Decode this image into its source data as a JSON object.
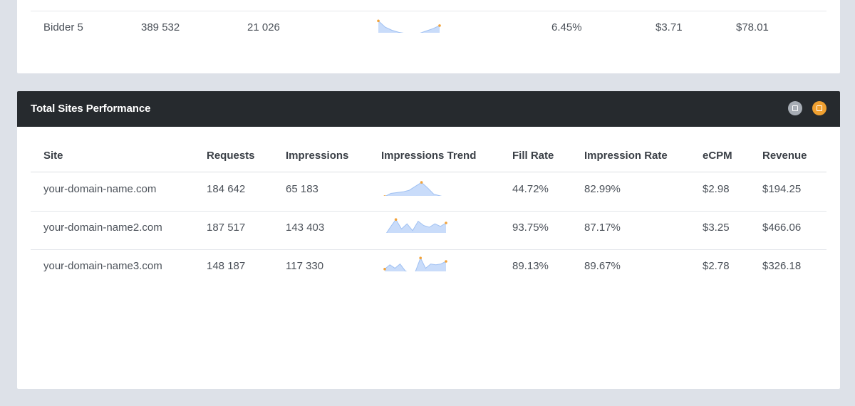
{
  "top_table": {
    "row": {
      "name": "Bidder 5",
      "requests": "389 532",
      "impressions": "21 026",
      "trend": [
        0.85,
        0.45,
        0.25,
        0.12,
        0.05,
        0.0,
        0.05,
        0.2,
        0.35,
        0.55
      ],
      "fill_rate": "6.45%",
      "ecpm": "$3.71",
      "revenue": "$78.01"
    }
  },
  "sites_panel": {
    "title": "Total Sites Performance",
    "controls": {
      "minimize_icon": "minimize-icon",
      "maximize_icon": "maximize-icon"
    },
    "columns": [
      "Site",
      "Requests",
      "Impressions",
      "Impressions Trend",
      "Fill Rate",
      "Impression Rate",
      "eCPM",
      "Revenue"
    ],
    "rows": [
      {
        "site": "your-domain-name.com",
        "requests": "184 642",
        "impressions": "65 183",
        "trend": [
          0.05,
          0.25,
          0.3,
          0.35,
          0.45,
          0.7,
          0.95,
          0.6,
          0.2,
          0.1,
          0.0
        ],
        "fill_rate": "44.72%",
        "impression_rate": "82.99%",
        "ecpm": "$2.98",
        "revenue": "$194.25"
      },
      {
        "site": "your-domain-name2.com",
        "requests": "187 517",
        "impressions": "143 403",
        "trend": [
          0.0,
          0.5,
          0.95,
          0.4,
          0.7,
          0.3,
          0.85,
          0.6,
          0.5,
          0.7,
          0.55,
          0.75
        ],
        "fill_rate": "93.75%",
        "impression_rate": "87.17%",
        "ecpm": "$3.25",
        "revenue": "$466.06"
      },
      {
        "site": "your-domain-name3.com",
        "requests": "148 187",
        "impressions": "117 330",
        "trend": [
          0.3,
          0.55,
          0.35,
          0.6,
          0.2,
          0.05,
          0.15,
          0.95,
          0.35,
          0.6,
          0.55,
          0.6,
          0.75
        ],
        "fill_rate": "89.13%",
        "impression_rate": "89.67%",
        "ecpm": "$2.78",
        "revenue": "$326.18"
      }
    ]
  },
  "colors": {
    "header_bg": "#262a2e",
    "spark_fill": "#c9dcfa",
    "spark_line": "#9fc0f2",
    "spark_dot": "#f2a33a",
    "btn_gray": "#a7adb5",
    "btn_orange": "#f0a030"
  }
}
